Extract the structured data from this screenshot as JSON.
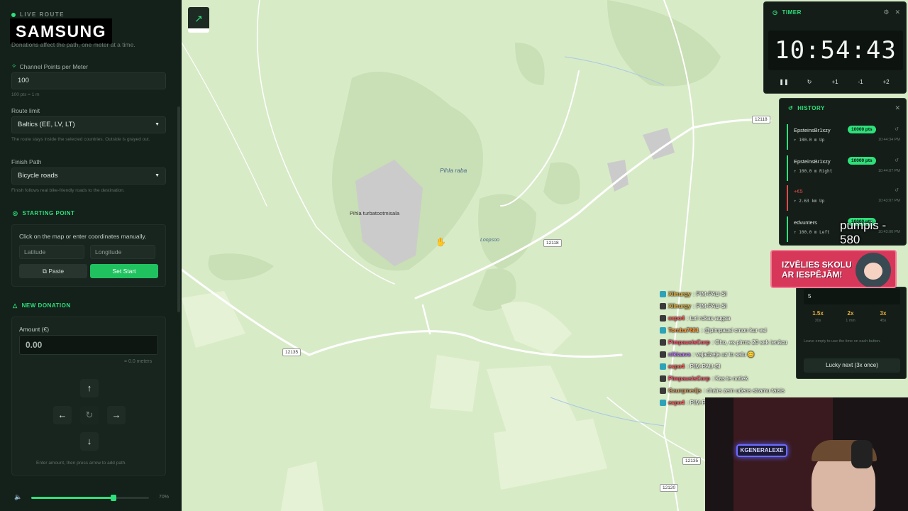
{
  "sidebar": {
    "live_route": "LIVE ROUTE",
    "brand": "SAMSUNG",
    "hint": "Donations affect the path, one meter at a time.",
    "cp_label": "Channel Points per Meter",
    "cp_value": "100",
    "cp_hint": "100 pts = 1 m",
    "route_limit_label": "Route limit",
    "route_limit_value": "Baltics (EE, LV, LT)",
    "route_limit_hint": "The route stays inside the selected countries. Outside is grayed out.",
    "finish_label": "Finish Path",
    "finish_value": "Bicycle roads",
    "finish_hint": "Finish follows real bike-friendly roads to the destination.",
    "start_title": "STARTING POINT",
    "start_text": "Click on the map or enter coordinates manually.",
    "lat_placeholder": "Latitude",
    "lon_placeholder": "Longitude",
    "paste_label": "Paste",
    "set_start_label": "Set Start",
    "donation_title": "NEW DONATION",
    "amount_label": "Amount (€)",
    "amount_value": "0.00",
    "meters_hint": "= 0.0 meters",
    "arrow_hint": "Enter amount, then press arrow to add path.",
    "volume_percent": 70,
    "volume_label": "70%"
  },
  "map": {
    "labels": {
      "pihla_raba": "Pihla raba",
      "turba": "Pihla turbatootmisala",
      "loopsoo": "Loopsoo"
    },
    "roads": {
      "r1": "12118",
      "r2": "12118",
      "r3": "12135",
      "r4": "12135",
      "r5": "12120"
    }
  },
  "timer": {
    "title": "TIMER",
    "display": "10:54:43",
    "controls": {
      "plus1": "+1",
      "minus1": "-1",
      "plus2": "+2"
    }
  },
  "history": {
    "title": "HISTORY",
    "items": [
      {
        "name": "EpsteinsBr1xzy",
        "pts": "10000 pts",
        "detail": "↑ 100.0 m Up",
        "time": "10:44:34 PM"
      },
      {
        "name": "EpsteinsBr1xzy",
        "pts": "10000 pts",
        "detail": "↑ 100.0 m Right",
        "time": "10:44:07 PM"
      },
      {
        "name": "+€5",
        "pts": "",
        "detail": "↑ 2.63 km Up",
        "time": "10:43:07 PM"
      },
      {
        "name": "edvunters",
        "pts": "10000 pts",
        "detail": "↑ 100.0 m Left",
        "time": "10:43:00 PM"
      }
    ]
  },
  "overlay": {
    "pumpis": "pumpis - 580",
    "ad_line1": "IZVĒLIES SKOLU",
    "ad_line2": "AR IESPĒJĀM!",
    "webcam_sign": "KGENERALEXE"
  },
  "lucky": {
    "input_value": "5",
    "multipliers": [
      {
        "value": "1.5x",
        "sub": "30s"
      },
      {
        "value": "2x",
        "sub": "1 min"
      },
      {
        "value": "3x",
        "sub": "45s"
      }
    ],
    "hint": "Leave empty to use the time on each button.",
    "button": "Lucky next (3x once)"
  },
  "chat": [
    {
      "user": "Xilnurgy",
      "msg": ": PIM-PAU-SI",
      "color": "#e5b040"
    },
    {
      "user": "Xilnurgy",
      "msg": ": PIM-PAU-SI",
      "color": "#e5b040"
    },
    {
      "user": "expo4",
      "msg": ": turi rokas augsa",
      "color": "#ff5b5b"
    },
    {
      "user": "Tomba7681",
      "msg": ": @pimpausi cmon kur esi",
      "color": "#ff9a3d"
    },
    {
      "user": "PimpausisCorp",
      "msg": ": Oho, es pirms 20 sek ienācu",
      "color": "#ff4f6d"
    },
    {
      "user": "nikiaava",
      "msg": ": vajadzeja uz to salu 😊",
      "color": "#c07bff"
    },
    {
      "user": "expo4",
      "msg": ": PIM-PAU-SI",
      "color": "#ff5b5b"
    },
    {
      "user": "PimpausisCorp",
      "msg": ": Kas te notiek",
      "color": "#ff4f6d"
    },
    {
      "user": "Gaurgmedjs",
      "msg": ": chairs zem udens stramu taisis",
      "color": "#d9a06b"
    },
    {
      "user": "expo4",
      "msg": ": PIM-PAU-SI",
      "color": "#ff5b5b"
    }
  ]
}
